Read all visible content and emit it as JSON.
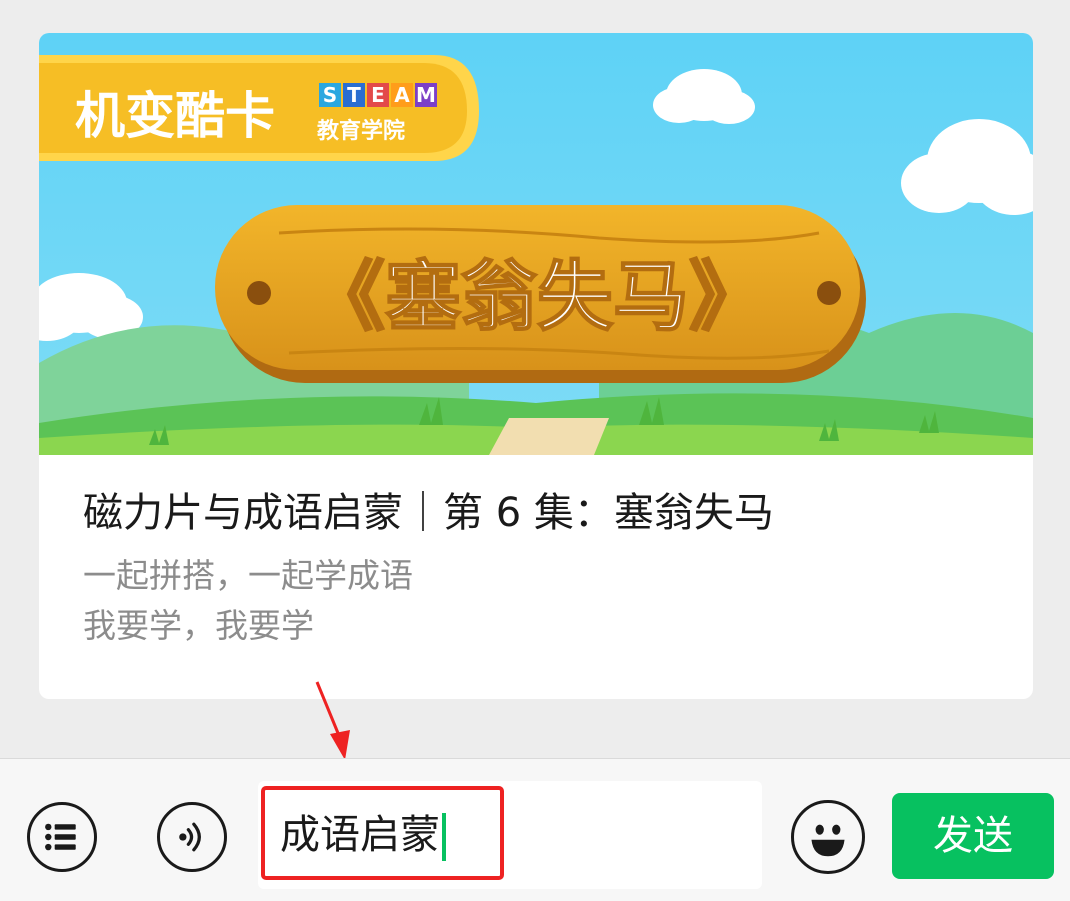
{
  "article": {
    "title": "磁力片与成语启蒙｜第 6 集：塞翁失马",
    "desc_line1": "一起拼搭，一起学成语",
    "desc_line2": "我要学，我要学",
    "banner": {
      "logo_text": "机变酷卡",
      "logo_sub": "教育学院",
      "steam_letters": [
        "S",
        "T",
        "E",
        "A",
        "M"
      ],
      "sign_text": "《塞翁失马》"
    }
  },
  "input": {
    "value": "成语启蒙"
  },
  "buttons": {
    "send_label": "发送"
  },
  "colors": {
    "accent": "#07c160",
    "highlight": "#ee2222",
    "sky": "#5fd3f6",
    "sign": "#e5a21a"
  }
}
